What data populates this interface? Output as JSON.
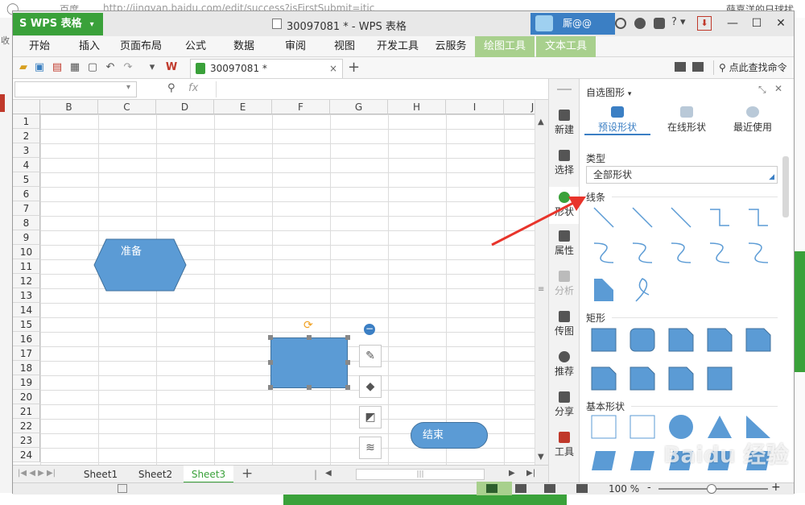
{
  "background": {
    "browser_url": "http://jingyan.baidu.com/edit/success?isFirstSubmit=itic",
    "browser_tab": "百度",
    "left_label": "收",
    "right_text": "薛嘉洋的日球扰"
  },
  "app": {
    "name": "WPS 表格",
    "doc_title": "30097081 * - WPS 表格",
    "user_name": "厮@@",
    "accent": "#3aa13a"
  },
  "menu": {
    "items": [
      "开始",
      "插入",
      "页面布局",
      "公式",
      "数据",
      "审阅",
      "视图",
      "开发工具",
      "云服务",
      "绘图工具",
      "文本工具"
    ],
    "active": [
      "绘图工具",
      "文本工具"
    ]
  },
  "toolbar": {
    "doc_tab_label": "30097081 *",
    "search_label": "点此查找命令",
    "add_tab": "+"
  },
  "formula": {
    "fx": "fx",
    "zoom_icon": "zoom-icon"
  },
  "grid": {
    "columns": [
      "B",
      "C",
      "D",
      "E",
      "F",
      "G",
      "H",
      "I",
      "J"
    ],
    "rows": [
      "1",
      "2",
      "3",
      "4",
      "5",
      "6",
      "7",
      "8",
      "9",
      "10",
      "11",
      "12",
      "13",
      "14",
      "15",
      "16",
      "17",
      "18",
      "19",
      "20",
      "21",
      "22",
      "23",
      "24"
    ]
  },
  "shapes": {
    "hexagon_label": "准备",
    "rounded_label": "结束",
    "fill_color": "#5b9bd5"
  },
  "sheets": {
    "tabs": [
      "Sheet1",
      "Sheet2",
      "Sheet3"
    ],
    "active": "Sheet3",
    "add": "+"
  },
  "status": {
    "zoom": "100 %",
    "minus": "-",
    "plus": "+"
  },
  "sidebar": {
    "items": [
      "新建",
      "选择",
      "形状",
      "属性",
      "分析",
      "传图",
      "推荐",
      "分享",
      "工具"
    ]
  },
  "panel": {
    "title": "自选图形",
    "tabs": [
      "预设形状",
      "在线形状",
      "最近使用"
    ],
    "type_label": "类型",
    "type_value": "全部形状",
    "sections": [
      "线条",
      "矩形",
      "基本形状"
    ]
  },
  "watermark": "Baidu 经验"
}
